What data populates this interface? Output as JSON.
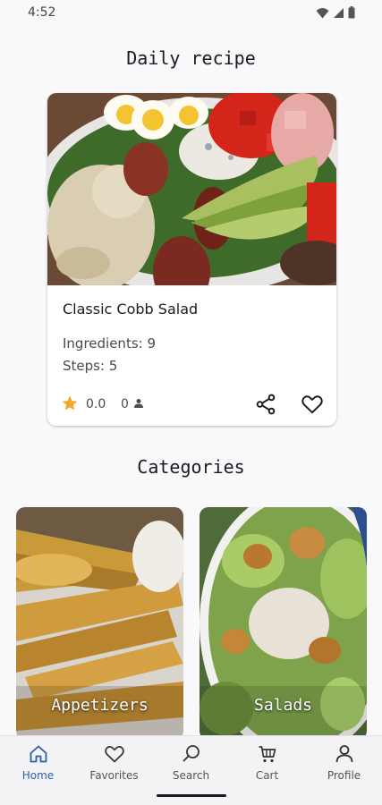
{
  "status": {
    "time": "4:52"
  },
  "daily": {
    "title": "Daily recipe",
    "recipe": {
      "name": "Classic Cobb Salad",
      "ingredients": "Ingredients: 9",
      "steps": "Steps: 5",
      "rating": "0.0",
      "users": "0"
    }
  },
  "categories": {
    "title": "Categories",
    "items": [
      {
        "label": "Appetizers"
      },
      {
        "label": "Salads"
      }
    ]
  },
  "nav": {
    "items": [
      {
        "label": "Home",
        "icon": "home-icon",
        "active": true
      },
      {
        "label": "Favorites",
        "icon": "heart-icon"
      },
      {
        "label": "Search",
        "icon": "search-icon"
      },
      {
        "label": "Cart",
        "icon": "cart-icon"
      },
      {
        "label": "Profile",
        "icon": "profile-icon"
      }
    ]
  },
  "colors": {
    "accent": "#2c5fa8",
    "star": "#f4a62a"
  }
}
